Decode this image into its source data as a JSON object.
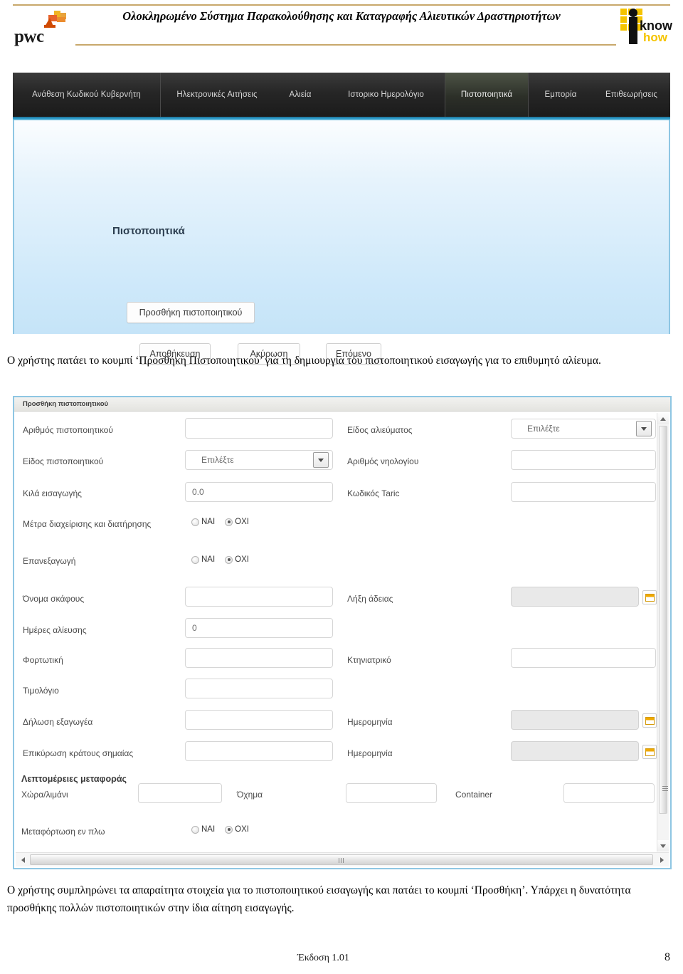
{
  "header": {
    "title": "Ολοκληρωμένο Σύστημα Παρακολούθησης και Καταγραφής Αλιευτικών Δραστηριοτήτων",
    "left_logo_text": "pwc",
    "right_logo_text_1": "i",
    "right_logo_text_2": "know",
    "right_logo_text_3": "how",
    "rule_color": "#c8a86b"
  },
  "nav": {
    "tabs": [
      {
        "label": "Ανάθεση Κωδικού Κυβερνήτη",
        "active": false
      },
      {
        "label": "Ηλεκτρονικές Αιτήσεις",
        "active": false
      },
      {
        "label": "Αλιεία",
        "active": false
      },
      {
        "label": "Ιστορικο Ημερολόγιο",
        "active": false
      },
      {
        "label": "Πιστοποιητικά",
        "active": true
      },
      {
        "label": "Εμπορία",
        "active": false
      },
      {
        "label": "Επιθεωρήσεις",
        "active": false
      }
    ],
    "accent_color": "#2e9fcd"
  },
  "certificates_panel": {
    "heading": "Πιστοποιητικά",
    "add_button": "Προσθήκη πιστοποιητικού",
    "save_button": "Αποθήκευση",
    "cancel_button": "Ακύρωση",
    "next_button": "Επόμενο"
  },
  "paragraphs": {
    "first": "Ο χρήστης πατάει το κουμπί ‘Προσθήκη Πιστοποιητικού’ για τη δημιουργία του πιστοποιητικού εισαγωγής για το επιθυμητό αλίευμα.",
    "second": "Ο χρήστης συμπληρώνει τα απαραίτητα στοιχεία για το πιστοποιητικού εισαγωγής και πατάει το κουμπί ‘Προσθήκη’. Υπάρχει η δυνατότητα προσθήκης πολλών πιστοποιητικών στην ίδια αίτηση εισαγωγής."
  },
  "dialog": {
    "title": "Προσθήκη πιστοποιητικού",
    "left_fields": [
      {
        "label": "Αριθμός πιστοποιητικού",
        "type": "text",
        "value": ""
      },
      {
        "label": "Είδος πιστοποιητικού",
        "type": "select",
        "value": "Επιλέξτε"
      },
      {
        "label": "Κιλά εισαγωγής",
        "type": "text",
        "value": "0.0"
      },
      {
        "label": "Μέτρα διαχείρισης και διατήρησης",
        "type": "radio",
        "value": "ΟΧΙ"
      },
      {
        "label": "Επανεξαγωγή",
        "type": "radio",
        "value": "ΟΧΙ"
      },
      {
        "label": "Όνομα σκάφους",
        "type": "text",
        "value": ""
      },
      {
        "label": "Ημέρες αλίευσης",
        "type": "text",
        "value": "0"
      },
      {
        "label": "Φορτωτική",
        "type": "text",
        "value": ""
      },
      {
        "label": "Τιμολόγιο",
        "type": "text",
        "value": ""
      },
      {
        "label": "Δήλωση εξαγωγέα",
        "type": "text",
        "value": ""
      },
      {
        "label": "Επικύρωση κράτους σημαίας",
        "type": "text",
        "value": ""
      }
    ],
    "right_fields": [
      {
        "label": "Είδος αλιεύματος",
        "type": "select",
        "value": "Επιλέξτε"
      },
      {
        "label": "Αριθμός νηολογίου",
        "type": "text",
        "value": ""
      },
      {
        "label": "Κωδικός Taric",
        "type": "text",
        "value": ""
      },
      {
        "label": "Λήξη άδειας",
        "type": "date",
        "value": ""
      },
      {
        "label": "Κτηνιατρικό",
        "type": "text",
        "value": ""
      },
      {
        "label": "Ημερομηνία",
        "type": "date",
        "value": ""
      },
      {
        "label": "Ημερομηνία",
        "type": "date",
        "value": ""
      }
    ],
    "radio_options": {
      "yes": "ΝΑΙ",
      "no": "ΟΧΙ"
    },
    "transport_section": {
      "title": "Λεπτομέρειες μεταφοράς",
      "country_port_label": "Χώρα/λιμάνι",
      "country_port_value": "",
      "vehicle_label": "Όχημα",
      "vehicle_value": "",
      "container_label": "Container",
      "container_value": "",
      "transshipment_label": "Μεταφόρτωση εν πλω",
      "transshipment_value": "ΟΧΙ"
    }
  },
  "footer": {
    "version": "Έκδοση 1.01",
    "page_number": "8"
  }
}
